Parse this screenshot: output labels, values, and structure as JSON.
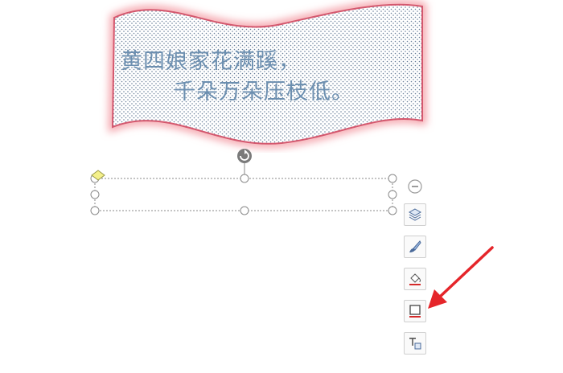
{
  "art_text": {
    "line1": "黄四娘家花满蹊，",
    "line2": "千朵万朵压枝低。"
  },
  "shape": {
    "fill_color": "#ffffff",
    "dot_color": "#6a7f9a",
    "outline_color": "#c0405a",
    "glow_color": "#f4a0a8",
    "handle_color": "#ffffff",
    "adjust_handle_color": "#f4f08a"
  },
  "toolbar": {
    "items": [
      {
        "icon": "minus-circle-icon"
      },
      {
        "icon": "layers-icon"
      },
      {
        "icon": "brush-icon"
      },
      {
        "icon": "fill-icon"
      },
      {
        "icon": "outline-icon"
      },
      {
        "icon": "text-box-icon"
      }
    ]
  },
  "annotation": {
    "arrow_color": "#e5252a"
  }
}
